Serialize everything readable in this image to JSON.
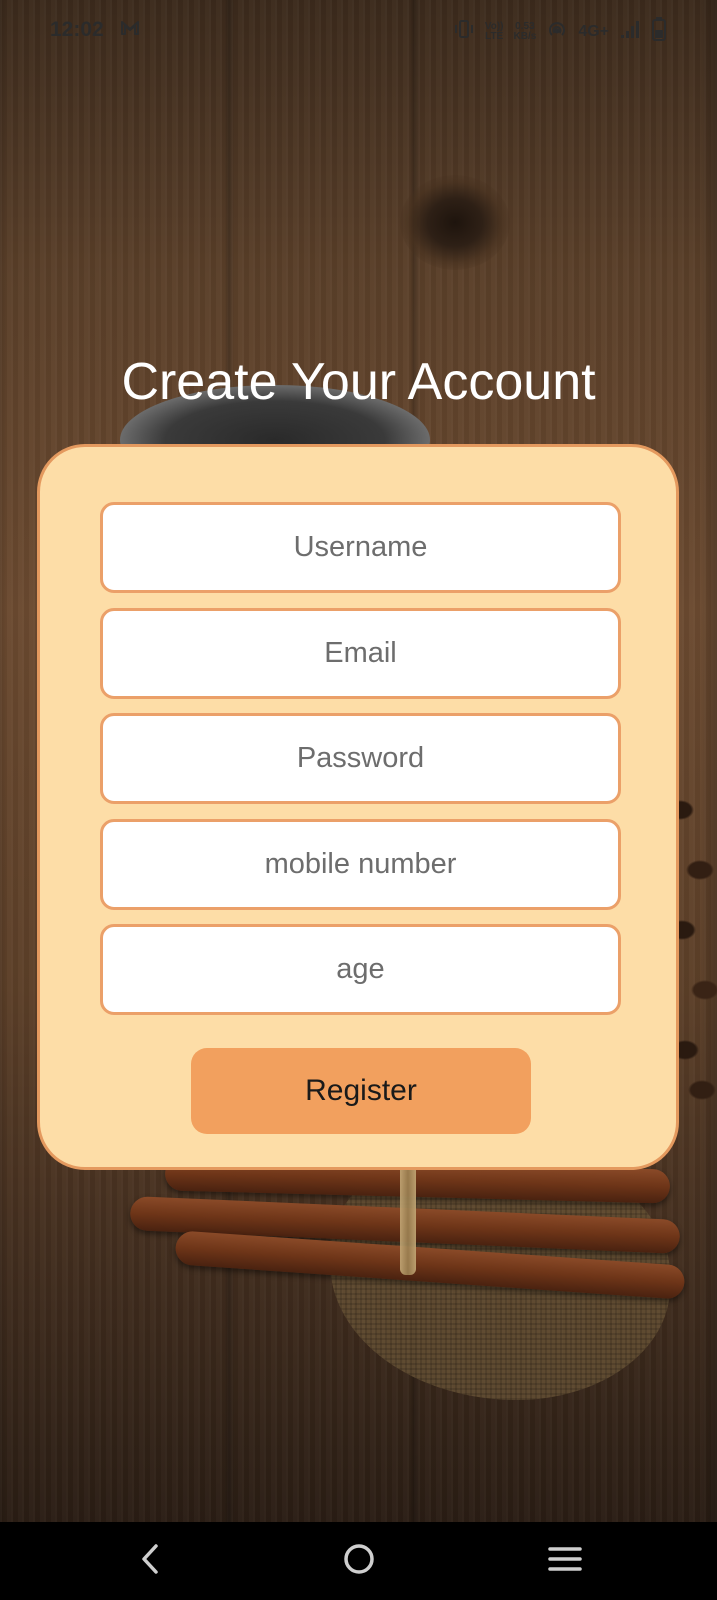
{
  "status_bar": {
    "time": "12:02",
    "mail_icon": "gmail-icon",
    "volte_top": "Vo))",
    "volte_bottom": "LTE",
    "speed_value": "0.53",
    "speed_unit": "KB/s",
    "network": "4G+",
    "icons": [
      "vibrate-icon",
      "hotspot-icon",
      "signal-icon",
      "battery-icon"
    ]
  },
  "page": {
    "title": "Create Your Account"
  },
  "form": {
    "username_placeholder": "Username",
    "email_placeholder": "Email",
    "password_placeholder": "Password",
    "mobile_placeholder": "mobile number",
    "age_placeholder": "age",
    "register_label": "Register"
  },
  "colors": {
    "card_background": "#fddda7",
    "card_border": "#e4995e",
    "field_border": "#eba069",
    "button_background": "#f2a05e",
    "title_text": "#ffffff"
  },
  "nav_bar": {
    "icons": [
      "back-icon",
      "home-icon",
      "menu-icon"
    ]
  }
}
